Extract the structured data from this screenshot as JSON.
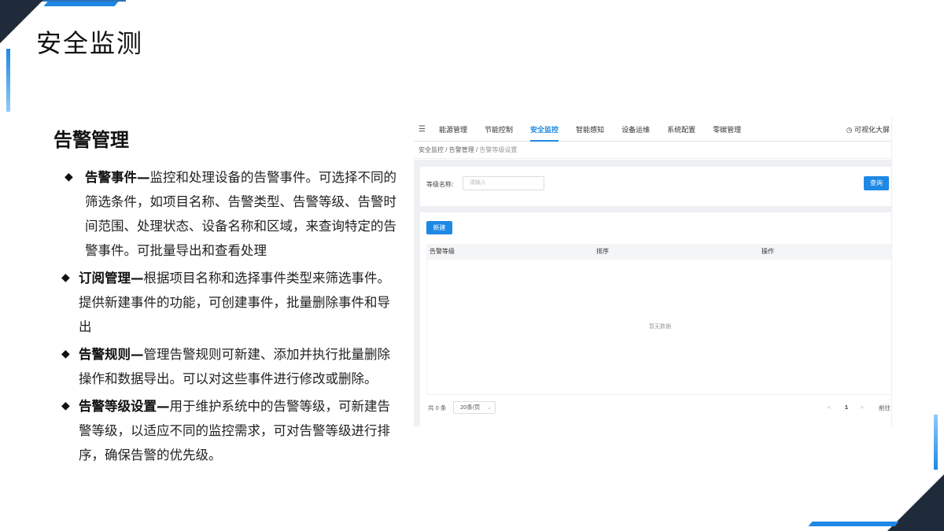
{
  "slide": {
    "title": "安全监测",
    "section_title": "告警管理",
    "bullets": [
      {
        "head": "告警事件—",
        "text": "监控和处理设备的告警事件。可选择不同的筛选条件，如项目名称、告警类型、告警等级、告警时间范围、处理状态、设备名称和区域，来查询特定的告警事件。可批量导出和查看处理"
      },
      {
        "head": "订阅管理—",
        "text": "根据项目名称和选择事件类型来筛选事件。提供新建事件的功能，可创建事件，批量删除事件和导出"
      },
      {
        "head": "告警规则—",
        "text": "管理告警规则可新建、添加并执行批量删除操作和数据导出。可以对这些事件进行修改或删除。"
      },
      {
        "head": "告警等级设置—",
        "text": "用于维护系统中的告警等级，可新建告警等级，以适应不同的监控需求，可对告警等级进行排序，确保告警的优先级。"
      }
    ],
    "bullet_symbol": "◆"
  },
  "app": {
    "menu_icon": "☰",
    "nav": [
      "能源管理",
      "节能控制",
      "安全监控",
      "智能感知",
      "设备运维",
      "系统配置",
      "零碳管理"
    ],
    "active_nav": "安全监控",
    "bigscreen_label": "◷ 可视化大屏",
    "breadcrumb": [
      "安全监控",
      "告警管理",
      "告警等级设置"
    ],
    "breadcrumb_sep": "/",
    "filter": {
      "label": "等级名称:",
      "placeholder": "请输入",
      "query_button": "查询"
    },
    "new_button": "新建",
    "table": {
      "columns": [
        "告警等级",
        "排序",
        "操作"
      ],
      "empty_text": "暂无数据"
    },
    "pager": {
      "total": "共 0 条",
      "page_size": "20条/页",
      "prev": "<",
      "page": "1",
      "next": ">",
      "goto": "前往"
    }
  },
  "colors": {
    "accent": "#1e88e5",
    "dark": "#1f2a3a"
  }
}
